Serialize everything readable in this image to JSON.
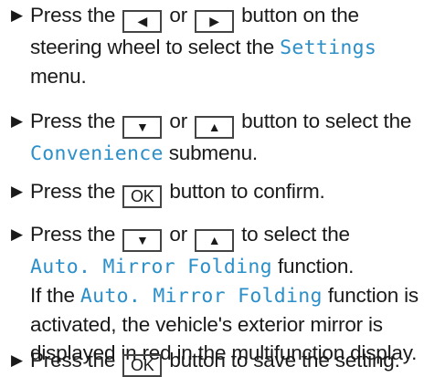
{
  "bullet": "▶",
  "highlight_color": "#2b8fc9",
  "steps": [
    {
      "a": "Press the",
      "k1": "◀",
      "b": "or",
      "k2": "▶",
      "c": "button on the",
      "d": "steering wheel to select the",
      "e": "Settings",
      "f": "menu."
    },
    {
      "a": "Press the",
      "k1": "▼",
      "b": "or",
      "k2": "▲",
      "c": "button to select the",
      "e": "Convenience",
      "f": "submenu."
    },
    {
      "a": "Press the",
      "k1": "OK",
      "c": "button to confirm."
    },
    {
      "a": "Press the",
      "k1": "▼",
      "b": "or",
      "k2": "▲",
      "c": "to select the",
      "e": "Auto. Mirror Folding",
      "f": "function.",
      "g": "If the",
      "h": "Auto. Mirror Folding",
      "i": "function is activated, the vehicle's exterior mirror is displayed in red in the multifunction display."
    },
    {
      "a": "Press the",
      "k1": "OK",
      "c": "button to save the setting."
    }
  ]
}
